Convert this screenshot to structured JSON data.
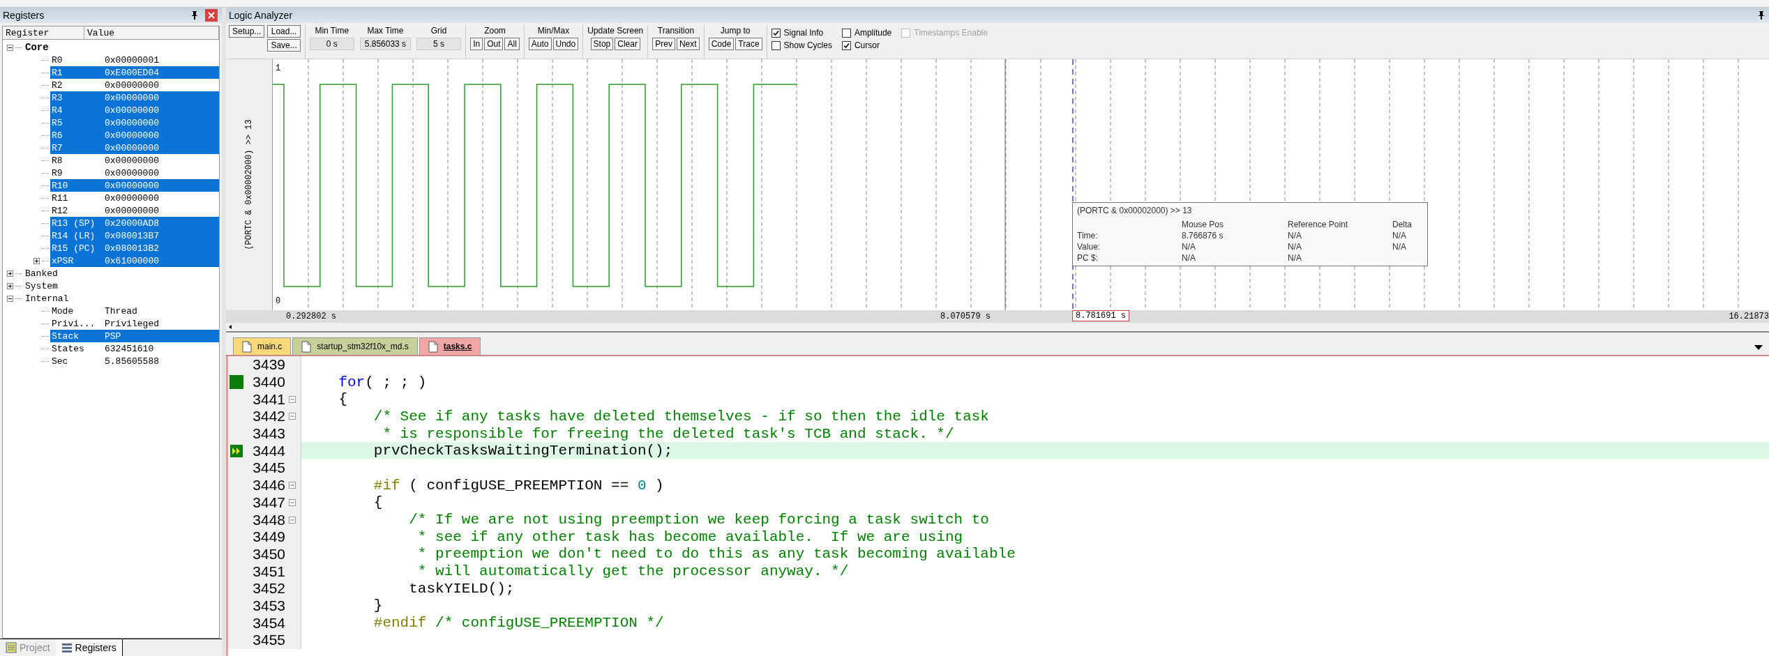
{
  "registers": {
    "title": "Registers",
    "columns": [
      "Register",
      "Value"
    ],
    "tree": [
      {
        "name": "Core",
        "expanded": true,
        "selected": false,
        "children": [
          {
            "name": "R0",
            "value": "0x00000001",
            "selected": false
          },
          {
            "name": "R1",
            "value": "0xE000ED04",
            "selected": true
          },
          {
            "name": "R2",
            "value": "0x00000000",
            "selected": false
          },
          {
            "name": "R3",
            "value": "0x00000000",
            "selected": true
          },
          {
            "name": "R4",
            "value": "0x00000000",
            "selected": true
          },
          {
            "name": "R5",
            "value": "0x00000000",
            "selected": true
          },
          {
            "name": "R6",
            "value": "0x00000000",
            "selected": true
          },
          {
            "name": "R7",
            "value": "0x00000000",
            "selected": true
          },
          {
            "name": "R8",
            "value": "0x00000000",
            "selected": false
          },
          {
            "name": "R9",
            "value": "0x00000000",
            "selected": false
          },
          {
            "name": "R10",
            "value": "0x00000000",
            "selected": true
          },
          {
            "name": "R11",
            "value": "0x00000000",
            "selected": false
          },
          {
            "name": "R12",
            "value": "0x00000000",
            "selected": false
          },
          {
            "name": "R13 (SP)",
            "value": "0x20000AD8",
            "selected": true
          },
          {
            "name": "R14 (LR)",
            "value": "0x080013B7",
            "selected": true
          },
          {
            "name": "R15 (PC)",
            "value": "0x080013B2",
            "selected": true
          },
          {
            "name": "xPSR",
            "value": "0x61000000",
            "selected": true,
            "expanded": false
          }
        ]
      },
      {
        "name": "Banked",
        "expanded": false,
        "selected": false
      },
      {
        "name": "System",
        "expanded": false,
        "selected": false
      },
      {
        "name": "Internal",
        "expanded": true,
        "selected": false,
        "children": [
          {
            "name": "Mode",
            "value": "Thread",
            "selected": false
          },
          {
            "name": "Privi...",
            "value": "Privileged",
            "selected": false
          },
          {
            "name": "Stack",
            "value": "PSP",
            "selected": true
          },
          {
            "name": "States",
            "value": "632451610",
            "selected": false
          },
          {
            "name": "Sec",
            "value": "5.85605588",
            "selected": false
          }
        ]
      }
    ],
    "bottom_tabs": [
      {
        "label": "Project",
        "selected": false
      },
      {
        "label": "Registers",
        "selected": true
      }
    ]
  },
  "logic_analyzer": {
    "title": "Logic Analyzer",
    "buttons": {
      "setup": "Setup...",
      "load": "Load...",
      "save": "Save..."
    },
    "fields": [
      {
        "label": "Min Time",
        "value": "0 s"
      },
      {
        "label": "Max Time",
        "value": "5.856033 s"
      },
      {
        "label": "Grid",
        "value": "5 s"
      }
    ],
    "groups": [
      {
        "label": "Zoom",
        "buttons": [
          "In",
          "Out",
          "All"
        ]
      },
      {
        "label": "Min/Max",
        "buttons": [
          "Auto",
          "Undo"
        ]
      },
      {
        "label": "Update Screen",
        "buttons": [
          "Stop",
          "Clear"
        ]
      },
      {
        "label": "Transition",
        "buttons": [
          "Prev",
          "Next"
        ]
      },
      {
        "label": "Jump to",
        "buttons": [
          "Code",
          "Trace"
        ]
      }
    ],
    "checkboxes": [
      {
        "label": "Signal Info",
        "checked": true,
        "disabled": false
      },
      {
        "label": "Show Cycles",
        "checked": false,
        "disabled": false
      },
      {
        "label": "Amplitude",
        "checked": false,
        "disabled": false
      },
      {
        "label": "Cursor",
        "checked": true,
        "disabled": false
      },
      {
        "label": "Timestamps Enable",
        "checked": false,
        "disabled": true
      }
    ],
    "signal": "(PORTC & 0x00002000) >> 13",
    "y_high": "1",
    "y_low": "0",
    "axis": [
      {
        "kind": "start",
        "text": "0.292802 s"
      },
      {
        "kind": "mark",
        "text": "8.070579 s"
      },
      {
        "kind": "cursor",
        "text": "8.781691 s"
      },
      {
        "kind": "end",
        "text": "16.21873"
      }
    ],
    "info": {
      "title": "(PORTC & 0x00002000) >> 13",
      "columns": [
        "Mouse Pos",
        "Reference Point",
        "Delta"
      ],
      "rows": [
        {
          "label": "Time:",
          "cells": [
            "8.766876 s",
            "N/A",
            "N/A"
          ]
        },
        {
          "label": "Value:",
          "cells": [
            "N/A",
            "N/A",
            "N/A"
          ]
        },
        {
          "label": "PC $:",
          "cells": [
            "N/A",
            "N/A"
          ]
        }
      ]
    }
  },
  "editor": {
    "tabs": [
      {
        "label": "main.c",
        "selected": false,
        "color": "#f7d97a"
      },
      {
        "label": "startup_stm32f10x_md.s",
        "selected": false,
        "color": "#c9cf9a"
      },
      {
        "label": "tasks.c",
        "selected": true,
        "color": "#f2a7a7"
      }
    ],
    "lines": [
      {
        "number": "3439",
        "fold": false,
        "kind": "plain",
        "current": false
      },
      {
        "number": "3440",
        "fold": false,
        "kind": "executed",
        "current": false,
        "code": [
          {
            "kind": "keyword",
            "text": "    for"
          },
          {
            "kind": "plain",
            "text": "( ; ; )"
          }
        ]
      },
      {
        "number": "3441",
        "fold": true,
        "kind": "plain",
        "current": false,
        "code": [
          {
            "kind": "plain",
            "text": "    {"
          }
        ]
      },
      {
        "number": "3442",
        "fold": true,
        "kind": "plain",
        "current": false,
        "code": [
          {
            "kind": "comment",
            "text": "        /* See if any tasks have deleted themselves - if so then the idle task"
          }
        ]
      },
      {
        "number": "3443",
        "fold": false,
        "kind": "plain",
        "current": false,
        "code": [
          {
            "kind": "comment",
            "text": "         * is responsible for freeing the deleted task's TCB and stack. */"
          }
        ]
      },
      {
        "number": "3444",
        "fold": false,
        "kind": "current",
        "current": true,
        "code": [
          {
            "kind": "plain",
            "text": "        prvCheckTasksWaitingTermination();"
          }
        ]
      },
      {
        "number": "3445",
        "fold": false,
        "kind": "plain",
        "current": false
      },
      {
        "number": "3446",
        "fold": true,
        "kind": "plain",
        "current": false,
        "code": [
          {
            "kind": "preproc",
            "text": "        #if"
          },
          {
            "kind": "plain",
            "text": " ( configUSE_PREEMPTION == "
          },
          {
            "kind": "number",
            "text": "0"
          },
          {
            "kind": "plain",
            "text": " )"
          }
        ]
      },
      {
        "number": "3447",
        "fold": true,
        "kind": "plain",
        "current": false,
        "code": [
          {
            "kind": "plain",
            "text": "        {"
          }
        ]
      },
      {
        "number": "3448",
        "fold": true,
        "kind": "plain",
        "current": false,
        "code": [
          {
            "kind": "comment",
            "text": "            /* If we are not using preemption we keep forcing a task switch to"
          }
        ]
      },
      {
        "number": "3449",
        "fold": false,
        "kind": "plain",
        "current": false,
        "code": [
          {
            "kind": "comment",
            "text": "             * see if any other task has become available.  If we are using"
          }
        ]
      },
      {
        "number": "3450",
        "fold": false,
        "kind": "plain",
        "current": false,
        "code": [
          {
            "kind": "comment",
            "text": "             * preemption we don't need to do this as any task becoming available"
          }
        ]
      },
      {
        "number": "3451",
        "fold": false,
        "kind": "plain",
        "current": false,
        "code": [
          {
            "kind": "comment",
            "text": "             * will automatically get the processor anyway. */"
          }
        ]
      },
      {
        "number": "3452",
        "fold": false,
        "kind": "plain",
        "current": false,
        "code": [
          {
            "kind": "plain",
            "text": "            taskYIELD();"
          }
        ]
      },
      {
        "number": "3453",
        "fold": false,
        "kind": "plain",
        "current": false,
        "code": [
          {
            "kind": "plain",
            "text": "        }"
          }
        ]
      },
      {
        "number": "3454",
        "fold": false,
        "kind": "plain",
        "current": false,
        "code": [
          {
            "kind": "preproc",
            "text": "        #endif"
          },
          {
            "kind": "comment",
            "text": " /* configUSE_PREEMPTION */"
          }
        ]
      },
      {
        "number": "3455",
        "fold": false,
        "kind": "plain",
        "current": false
      }
    ]
  }
}
